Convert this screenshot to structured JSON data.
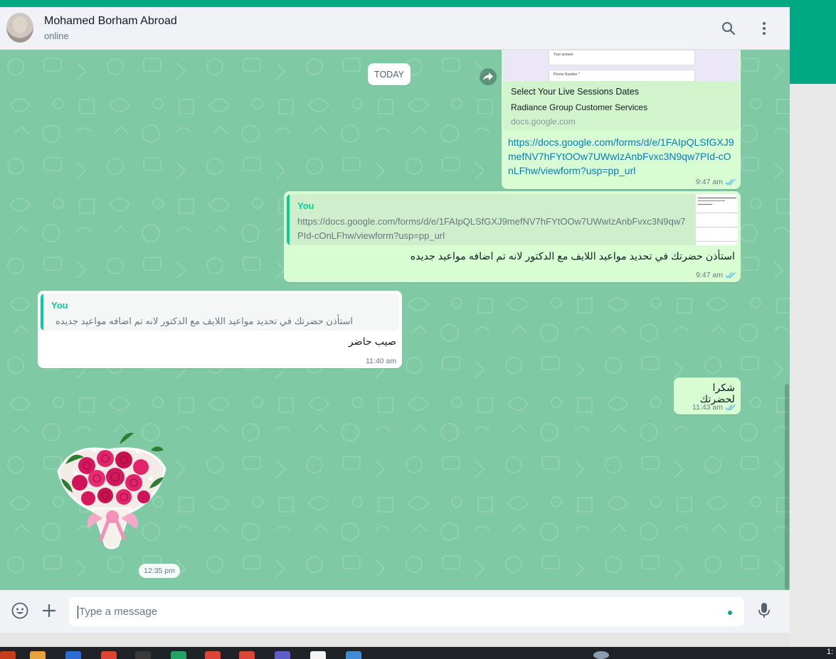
{
  "contact": {
    "name": "Mohamed Borham Abroad",
    "status": "online"
  },
  "chat": {
    "date_chip": "TODAY",
    "messages": [
      {
        "id": "msg1",
        "direction": "outgoing",
        "form_preview": {
          "field1": "Your answer",
          "field2": "Phone Number *"
        },
        "link_preview": {
          "title": "Select Your Live Sessions Dates",
          "description": "Radiance Group Customer Services",
          "domain": "docs.google.com"
        },
        "text": "https://docs.google.com/forms/d/e/1FAIpQLSfGXJ9mefNV7hFYtOOw7UWwIzAnbFvxc3N9qw7PId-cOnLFhw/viewform?usp=pp_url",
        "time": "9:47 am",
        "status": "read"
      },
      {
        "id": "msg2",
        "direction": "outgoing",
        "quote": {
          "author": "You",
          "line1": "https://docs.google.com/forms/d/e/1FAIpQLSfGXJ9mefNV7hFYtOOw7UWwIzAnbFvxc3N9qw7",
          "line2": "PId-cOnLFhw/viewform?usp=pp_url"
        },
        "text": "استأذن حضرتك في تحديد مواعيد اللايف مع الدكتور لانه تم اضافه مواعيد جديده",
        "time": "9:47 am",
        "status": "read"
      },
      {
        "id": "msg3",
        "direction": "incoming",
        "quote": {
          "author": "You",
          "line1": "استأذن حضرتك في تحديد مواعيد اللايف مع الدكتور لانه تم اضافه مواعيد جديده"
        },
        "text": "صيب حاضر",
        "time": "11:40 am"
      },
      {
        "id": "msg4",
        "direction": "outgoing",
        "text": "شكرا لحضرتك",
        "time": "11:43 am",
        "status": "read"
      },
      {
        "id": "msg5",
        "direction": "incoming",
        "type": "sticker",
        "sticker": "flower-bouquet",
        "time": "12:35 pm"
      }
    ]
  },
  "composer": {
    "placeholder": "Type a message"
  },
  "icons": {
    "search": "search-icon",
    "menu": "kebab-menu-icon",
    "forward": "forward-icon",
    "emoji": "emoji-icon",
    "attach": "plus-icon",
    "mic": "microphone-icon",
    "read": "double-check-icon"
  },
  "colors": {
    "accent": "#00a884",
    "outgoing_bubble": "#d9fdd3",
    "incoming_bubble": "#ffffff",
    "chat_background": "#7fcaa4",
    "link": "#027eb5",
    "read_tick": "#53bdeb"
  },
  "taskbar": {
    "clock": "1:"
  }
}
